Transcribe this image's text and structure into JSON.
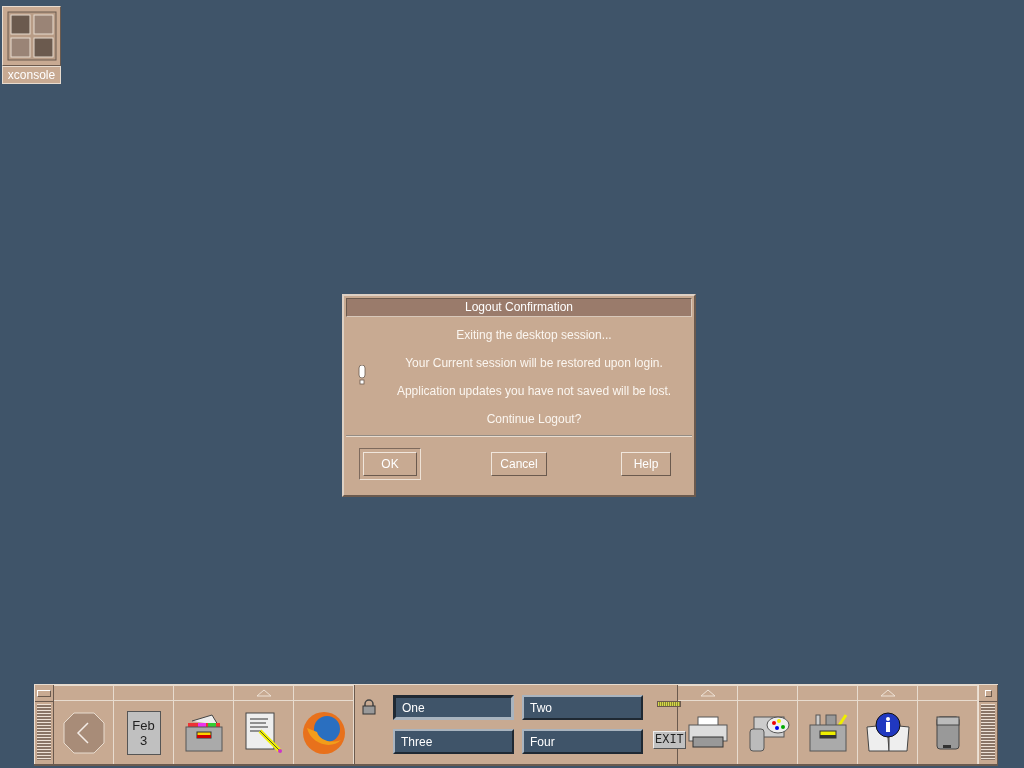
{
  "desktop_icons": [
    {
      "label": "xconsole"
    }
  ],
  "dialog": {
    "title": "Logout Confirmation",
    "messages": [
      "Exiting the desktop session...",
      "Your Current session will be restored upon login.",
      "Application updates you have not saved will be lost.",
      "Continue Logout?"
    ],
    "buttons": [
      {
        "label": "OK",
        "default": true
      },
      {
        "label": "Cancel",
        "default": false
      },
      {
        "label": "Help",
        "default": false
      }
    ]
  },
  "front_panel": {
    "launchers_left": [
      {
        "kind": "clock",
        "has_subpanel": false
      },
      {
        "kind": "calendar",
        "month": "Feb",
        "day": "3",
        "has_subpanel": false
      },
      {
        "kind": "files",
        "has_subpanel": false
      },
      {
        "kind": "editor",
        "has_subpanel": true
      },
      {
        "kind": "browser",
        "has_subpanel": false
      }
    ],
    "workspaces": [
      {
        "label": "One",
        "selected": true
      },
      {
        "label": "Two",
        "selected": false
      },
      {
        "label": "Three",
        "selected": false
      },
      {
        "label": "Four",
        "selected": false
      }
    ],
    "exit": {
      "label": "EXIT"
    },
    "launchers_right": [
      {
        "kind": "printer",
        "has_subpanel": true
      },
      {
        "kind": "style",
        "has_subpanel": false
      },
      {
        "kind": "apps",
        "has_subpanel": false
      },
      {
        "kind": "help",
        "has_subpanel": true
      },
      {
        "kind": "trash",
        "has_subpanel": false
      }
    ]
  }
}
